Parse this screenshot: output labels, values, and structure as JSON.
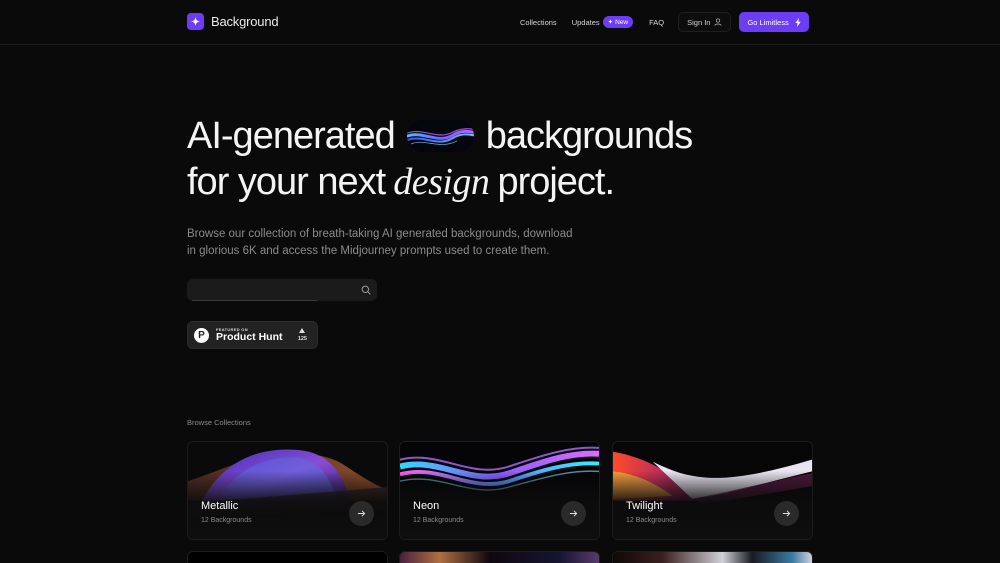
{
  "nav": {
    "brand": "Background",
    "links": {
      "collections": "Collections",
      "updates": "Updates",
      "updates_badge": "New",
      "faq": "FAQ",
      "sign_in": "Sign In",
      "cta": "Go Limitless"
    }
  },
  "hero": {
    "title_line1_a": "AI-generated",
    "title_line1_b": "backgrounds",
    "title_line2_a": "for your next",
    "title_line2_italic": "design",
    "title_line2_b": "project.",
    "description": "Browse our collection of breath-taking AI generated backgrounds, download in glorious 6K and access the Midjourney prompts used to create them.",
    "search": {
      "value": "",
      "placeholder": ""
    }
  },
  "product_hunt": {
    "eyebrow": "FEATURED ON",
    "name": "Product Hunt",
    "votes": "125"
  },
  "collections": {
    "label": "Browse Collections",
    "items": [
      {
        "title": "Metallic",
        "count": "12 Backgrounds"
      },
      {
        "title": "Neon",
        "count": "12 Backgrounds"
      },
      {
        "title": "Twilight",
        "count": "12 Backgrounds"
      }
    ]
  },
  "colors": {
    "accent": "#6d3cf5",
    "background": "#0a0a0a",
    "muted_text": "#8b8b8b"
  }
}
